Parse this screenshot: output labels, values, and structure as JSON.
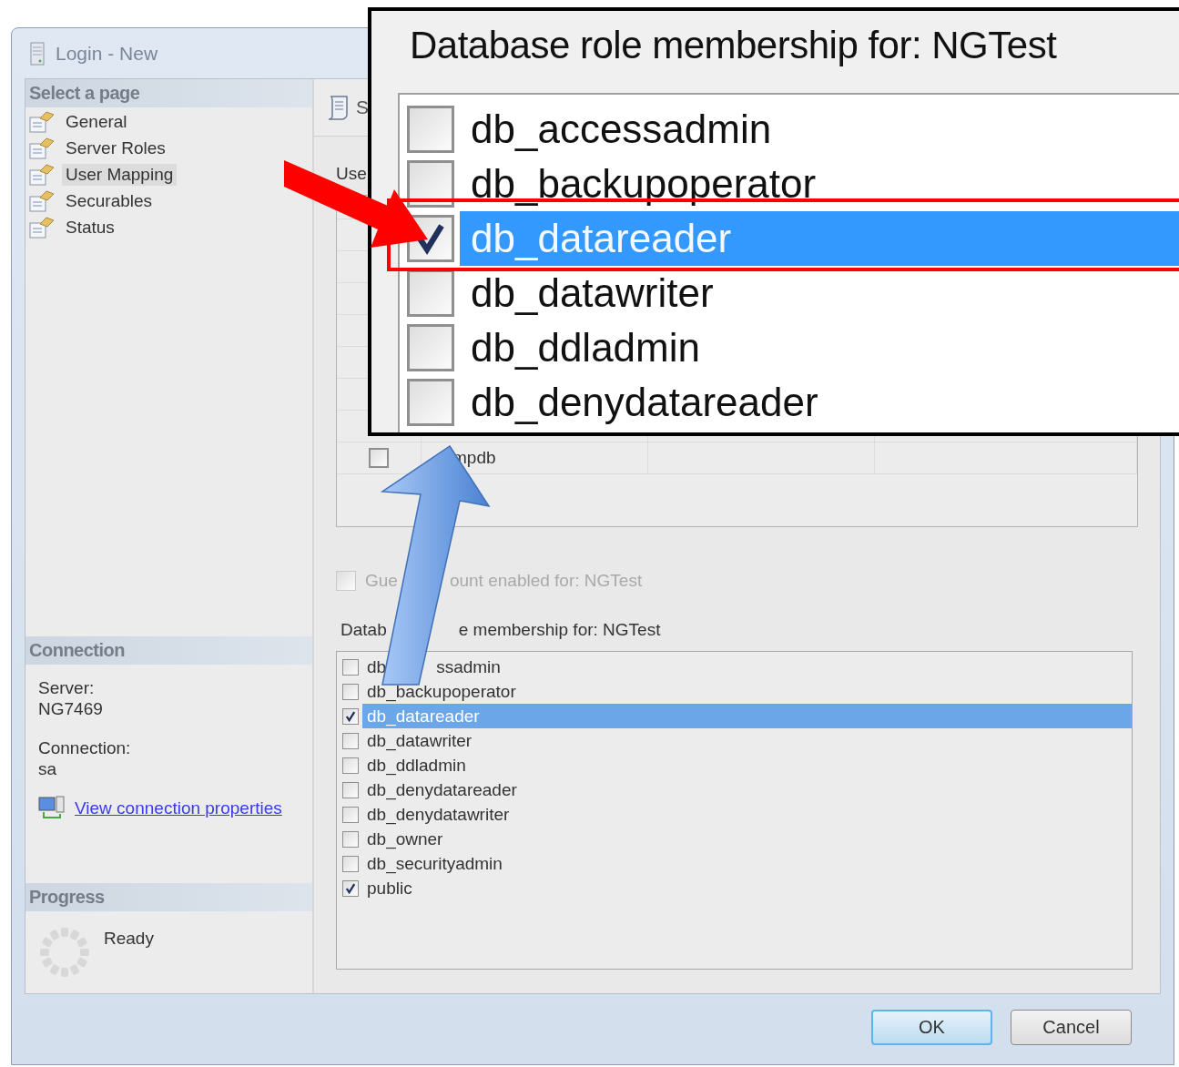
{
  "window": {
    "title": "Login - New"
  },
  "sidebar": {
    "header": "Select a page",
    "items": [
      {
        "label": "General",
        "selected": false
      },
      {
        "label": "Server Roles",
        "selected": false
      },
      {
        "label": "User Mapping",
        "selected": true
      },
      {
        "label": "Securables",
        "selected": false
      },
      {
        "label": "Status",
        "selected": false
      }
    ]
  },
  "connection": {
    "header": "Connection",
    "server_label": "Server:",
    "server": "NG7469",
    "connection_label": "Connection:",
    "connection": "sa",
    "link": "View connection properties"
  },
  "progress": {
    "header": "Progress",
    "status": "Ready"
  },
  "toolbar": {
    "button": "S"
  },
  "users_label": "Use",
  "users_table": {
    "rows": [
      {
        "checked": false,
        "database": "mpdb"
      }
    ]
  },
  "guest": {
    "label": "Gue",
    "label_after_arrow": "ount enabled for: NGTest",
    "checked": false,
    "disabled": true
  },
  "roles_label": {
    "label": "Datab",
    "label_after_arrow": "e membership for: NGTest"
  },
  "roles": [
    {
      "label": "db",
      "label_after_arrow": "ssadmin",
      "checked": false,
      "selected": false
    },
    {
      "label": "db_backupoperator",
      "checked": false,
      "selected": false
    },
    {
      "label": "db_datareader",
      "checked": true,
      "selected": true
    },
    {
      "label": "db_datawriter",
      "checked": false,
      "selected": false
    },
    {
      "label": "db_ddladmin",
      "checked": false,
      "selected": false
    },
    {
      "label": "db_denydatareader",
      "checked": false,
      "selected": false
    },
    {
      "label": "db_denydatawriter",
      "checked": false,
      "selected": false
    },
    {
      "label": "db_owner",
      "checked": false,
      "selected": false
    },
    {
      "label": "db_securityadmin",
      "checked": false,
      "selected": false
    },
    {
      "label": "public",
      "checked": true,
      "selected": false
    }
  ],
  "buttons": [
    {
      "label": "OK",
      "default": true
    },
    {
      "label": "Cancel",
      "default": false
    }
  ],
  "callout": {
    "title": "Database role membership for: NGTest",
    "roles": [
      {
        "label": "db_accessadmin",
        "checked": false,
        "selected": false
      },
      {
        "label": "db_backupoperator",
        "checked": false,
        "selected": false
      },
      {
        "label": "db_datareader",
        "checked": true,
        "selected": true
      },
      {
        "label": "db_datawriter",
        "checked": false,
        "selected": false
      },
      {
        "label": "db_ddladmin",
        "checked": false,
        "selected": false
      },
      {
        "label": "db_denydatareader",
        "checked": false,
        "selected": false
      }
    ]
  }
}
